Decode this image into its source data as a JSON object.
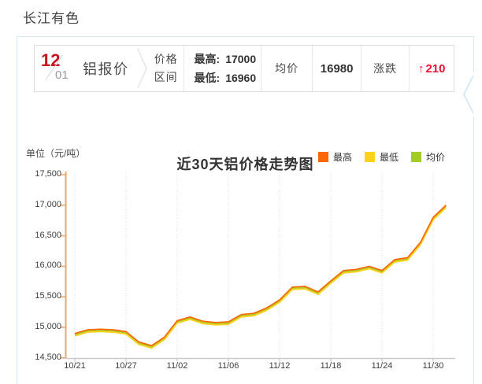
{
  "page": {
    "title": "长江有色"
  },
  "quote_bar": {
    "date": {
      "month": "12",
      "day": "01"
    },
    "product": "铝报价",
    "range_label_line1": "价格",
    "range_label_line2": "区间",
    "high_label": "最高:",
    "high_value": "17000",
    "low_label": "最低:",
    "low_value": "16960",
    "avg_label": "均价",
    "avg_value": "16980",
    "change_label": "涨跌",
    "change_arrow": "↑",
    "change_value": "210"
  },
  "chart": {
    "title": "近30天铝价格走势图",
    "unit_label": "单位（元/吨）",
    "legend": [
      {
        "label": "最高",
        "color": "#ff6600"
      },
      {
        "label": "最低",
        "color": "#ffd11a"
      },
      {
        "label": "均价",
        "color": "#a3cc29"
      }
    ]
  },
  "chart_data": {
    "type": "line",
    "title": "近30天铝价格走势图",
    "unit": "元/吨",
    "n_points": 30,
    "x_tick_labels": [
      "10/21",
      "10/27",
      "11/02",
      "11/06",
      "11/12",
      "11/18",
      "11/24",
      "11/30"
    ],
    "x_tick_every": 4,
    "ylim": [
      14500,
      17500
    ],
    "y_ticks": [
      14500,
      15000,
      15500,
      16000,
      16500,
      17000,
      17500
    ],
    "grid": "vertical-dotted",
    "legend_position": "top-right",
    "series": [
      {
        "name": "最高",
        "color": "#ff6600",
        "values": [
          14900,
          14960,
          14970,
          14960,
          14930,
          14760,
          14700,
          14840,
          15110,
          15170,
          15100,
          15080,
          15090,
          15210,
          15230,
          15320,
          15450,
          15660,
          15670,
          15580,
          15760,
          15930,
          15950,
          16000,
          15930,
          16110,
          16140,
          16390,
          16800,
          17000
        ]
      },
      {
        "name": "最低",
        "color": "#ffd11a",
        "values": [
          14860,
          14920,
          14930,
          14920,
          14890,
          14720,
          14660,
          14800,
          15070,
          15130,
          15060,
          15040,
          15050,
          15170,
          15190,
          15280,
          15410,
          15620,
          15630,
          15540,
          15720,
          15890,
          15910,
          15960,
          15890,
          16070,
          16100,
          16350,
          16760,
          16960
        ]
      },
      {
        "name": "均价",
        "color": "#a3cc29",
        "values": [
          14880,
          14940,
          14950,
          14940,
          14910,
          14740,
          14680,
          14820,
          15090,
          15150,
          15080,
          15060,
          15070,
          15190,
          15210,
          15300,
          15430,
          15640,
          15650,
          15560,
          15740,
          15910,
          15930,
          15980,
          15910,
          16090,
          16120,
          16370,
          16780,
          16980
        ]
      }
    ]
  },
  "colors": {
    "accent_red": "#ef0f35",
    "date_red": "#c8151e",
    "y_axis": "#f2a366",
    "x_axis": "#c9c9c9",
    "gridline": "#dedede",
    "panel_border": "#d4e8f6"
  }
}
